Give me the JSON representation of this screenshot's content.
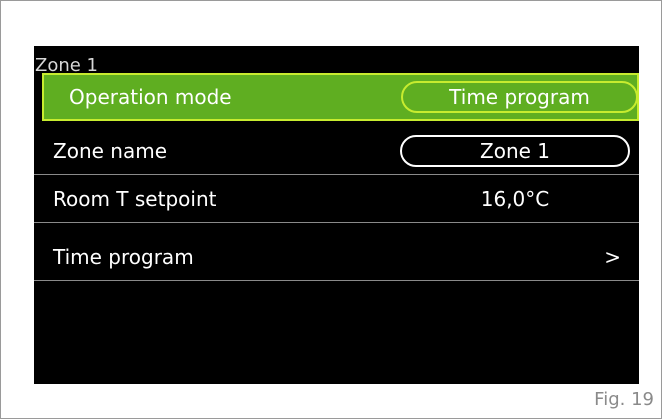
{
  "screen": {
    "zone_title": "Zone 1",
    "rows": [
      {
        "label": "Operation mode",
        "value": "Time program"
      },
      {
        "label": "Zone name",
        "value": "Zone 1"
      },
      {
        "label": "Room T setpoint",
        "value": "16,0°C"
      },
      {
        "label": "Time program",
        "value": ">"
      }
    ]
  },
  "caption": "Fig. 19",
  "colors": {
    "selected_bg": "#5fae21",
    "selected_border": "#c7ec2f",
    "screen_bg": "#000000"
  }
}
